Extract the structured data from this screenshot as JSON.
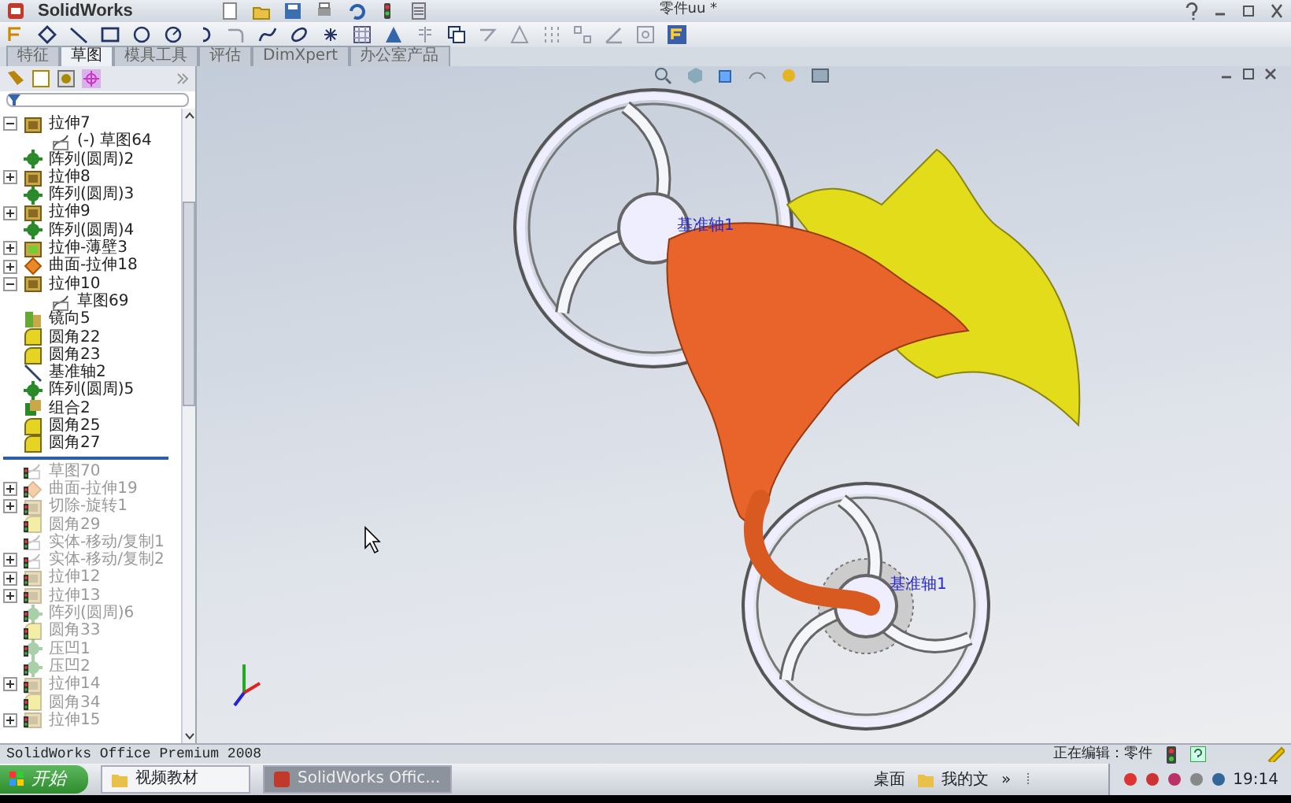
{
  "app": {
    "logo": "SolidWorks",
    "title": "零件uu *"
  },
  "command_tabs": [
    {
      "label": "特征",
      "selected": false
    },
    {
      "label": "草图",
      "selected": true
    },
    {
      "label": "模具工具",
      "selected": false
    },
    {
      "label": "评估",
      "selected": false
    },
    {
      "label": "DimXpert",
      "selected": false
    },
    {
      "label": "办公室产品",
      "selected": false
    }
  ],
  "feature_tree": {
    "items": [
      {
        "label": "拉伸7",
        "kind": "extrude",
        "expanded": true,
        "rolled_back": false,
        "children": [
          {
            "label": "(-) 草图64",
            "kind": "sketch",
            "rolled_back": false
          }
        ]
      },
      {
        "label": "阵列(圆周)2",
        "kind": "pattern",
        "rolled_back": false
      },
      {
        "label": "拉伸8",
        "kind": "extrude",
        "expanded": false,
        "rolled_back": false
      },
      {
        "label": "阵列(圆周)3",
        "kind": "pattern",
        "rolled_back": false
      },
      {
        "label": "拉伸9",
        "kind": "extrude",
        "expanded": false,
        "rolled_back": false
      },
      {
        "label": "阵列(圆周)4",
        "kind": "pattern",
        "rolled_back": false
      },
      {
        "label": "拉伸-薄壁3",
        "kind": "thin",
        "expanded": false,
        "rolled_back": false
      },
      {
        "label": "曲面-拉伸18",
        "kind": "surface",
        "expanded": false,
        "rolled_back": false
      },
      {
        "label": "拉伸10",
        "kind": "extrude",
        "expanded": true,
        "rolled_back": false,
        "children": [
          {
            "label": "草图69",
            "kind": "sketch",
            "rolled_back": false
          }
        ]
      },
      {
        "label": "镜向5",
        "kind": "mirror",
        "rolled_back": false
      },
      {
        "label": "圆角22",
        "kind": "fillet",
        "rolled_back": false
      },
      {
        "label": "圆角23",
        "kind": "fillet",
        "rolled_back": false
      },
      {
        "label": "基准轴2",
        "kind": "axis",
        "rolled_back": false
      },
      {
        "label": "阵列(圆周)5",
        "kind": "pattern",
        "rolled_back": false
      },
      {
        "label": "组合2",
        "kind": "combine",
        "rolled_back": false
      },
      {
        "label": "圆角25",
        "kind": "fillet",
        "rolled_back": false
      },
      {
        "label": "圆角27",
        "kind": "fillet",
        "rolled_back": false
      },
      {
        "label": "草图70",
        "kind": "sketch",
        "rolled_back": true
      },
      {
        "label": "曲面-拉伸19",
        "kind": "surface",
        "expanded": false,
        "rolled_back": true
      },
      {
        "label": "切除-旋转1",
        "kind": "extrude",
        "expanded": false,
        "rolled_back": true
      },
      {
        "label": "圆角29",
        "kind": "fillet",
        "rolled_back": true
      },
      {
        "label": "实体-移动/复制1",
        "kind": "sketch",
        "rolled_back": true
      },
      {
        "label": "实体-移动/复制2",
        "kind": "sketch",
        "expanded": false,
        "rolled_back": true
      },
      {
        "label": "拉伸12",
        "kind": "extrude",
        "expanded": false,
        "rolled_back": true
      },
      {
        "label": "拉伸13",
        "kind": "extrude",
        "expanded": false,
        "rolled_back": true
      },
      {
        "label": "阵列(圆周)6",
        "kind": "pattern",
        "rolled_back": true
      },
      {
        "label": "圆角33",
        "kind": "fillet",
        "rolled_back": true
      },
      {
        "label": "压凹1",
        "kind": "pattern",
        "rolled_back": true
      },
      {
        "label": "压凹2",
        "kind": "pattern",
        "rolled_back": true
      },
      {
        "label": "拉伸14",
        "kind": "extrude",
        "expanded": false,
        "rolled_back": true
      },
      {
        "label": "圆角34",
        "kind": "fillet",
        "rolled_back": true
      },
      {
        "label": "拉伸15",
        "kind": "extrude",
        "expanded": false,
        "rolled_back": true
      }
    ]
  },
  "viewport": {
    "axis_labels": [
      "基准轴1",
      "基准轴1"
    ]
  },
  "status_bar": {
    "product": "SolidWorks Office Premium 2008",
    "mode": "正在编辑：零件"
  },
  "taskbar": {
    "start": "开始",
    "buttons": [
      {
        "label": "视频教材",
        "selected": false
      },
      {
        "label": "SolidWorks Offic...",
        "selected": true
      }
    ],
    "desktop": "桌面",
    "folder": "我的文",
    "more": "»",
    "clock": "19:14"
  }
}
